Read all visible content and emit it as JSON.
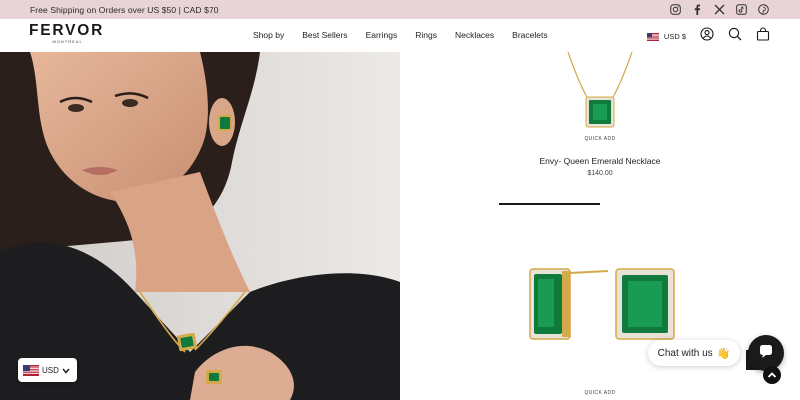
{
  "announcement": {
    "text": "Free Shipping on Orders over US $50 | CAD $70"
  },
  "social_icons": [
    "instagram-icon",
    "facebook-icon",
    "x-icon",
    "tiktok-icon",
    "pinterest-icon"
  ],
  "header": {
    "logo": "FERVOR",
    "logo_sub": "MONTREAL",
    "nav": [
      "Shop by",
      "Best Sellers",
      "Earrings",
      "Rings",
      "Necklaces",
      "Bracelets"
    ],
    "currency": "USD $",
    "icons": [
      "account-icon",
      "search-icon",
      "cart-icon"
    ]
  },
  "products": [
    {
      "quick_add": "QUICK ADD",
      "title": "Envy- Queen Emerald Necklace",
      "price": "$140.00"
    },
    {
      "quick_add": "QUICK ADD"
    }
  ],
  "currency_selector": {
    "value": "USD"
  },
  "chat": {
    "label": "Chat with us",
    "emoji": "👋"
  },
  "colors": {
    "announcement_bg": "#e8d3d6",
    "emerald": "#0f7a3c",
    "gold": "#d4a94a",
    "dark": "#1a1a1a"
  }
}
